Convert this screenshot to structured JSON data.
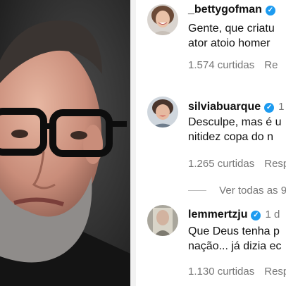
{
  "comments": [
    {
      "username": "_bettygofman",
      "time": "",
      "text_lines": [
        "Gente, que criatu",
        "ator atoio homer"
      ],
      "likes": "1.574 curtidas",
      "reply": "Re"
    },
    {
      "username": "silviabuarque",
      "time": "1",
      "text_lines": [
        "Desculpe, mas é u",
        "nitidez copa do n"
      ],
      "likes": "1.265 curtidas",
      "reply": "Resp"
    },
    {
      "username": "lemmertzju",
      "time": "1 d",
      "text_lines": [
        "Que Deus tenha p",
        "nação... já dizia ec"
      ],
      "likes": "1.130 curtidas",
      "reply": "Resp"
    }
  ],
  "view_all": "Ver todas as 9",
  "colors": {
    "verified": "#1d9bf0",
    "meta": "#777777"
  }
}
